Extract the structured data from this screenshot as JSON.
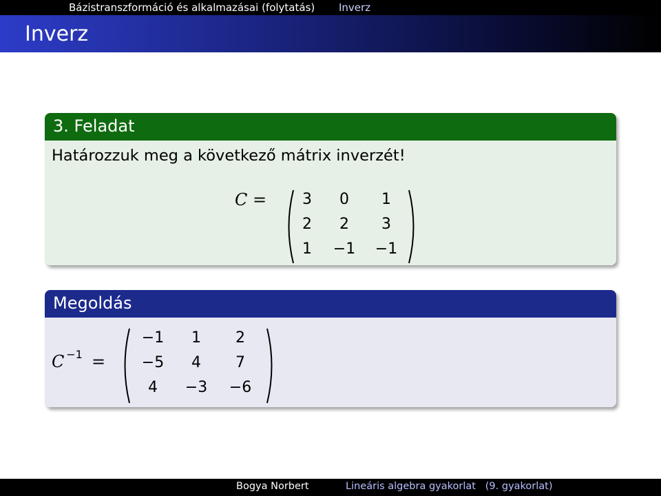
{
  "header": {
    "section": "Bázistranszformáció és alkalmazásai (folytatás)",
    "subsection": "Inverz"
  },
  "frame_title": "Inverz",
  "exercise": {
    "title": "3. Feladat",
    "text": "Határozzuk meg a következő mátrix inverzét!",
    "lhs": "C =",
    "matrix": [
      [
        "3",
        "0",
        "1"
      ],
      [
        "2",
        "2",
        "3"
      ],
      [
        "1",
        "−1",
        "−1"
      ]
    ]
  },
  "solution": {
    "title": "Megoldás",
    "lhs_base": "C",
    "lhs_exp": "−1",
    "lhs_eq": "=",
    "matrix": [
      [
        "−1",
        "1",
        "2"
      ],
      [
        "−5",
        "4",
        "7"
      ],
      [
        "4",
        "−3",
        "−6"
      ]
    ]
  },
  "footer": {
    "author": "Bogya Norbert",
    "course": "Lineáris algebra gyakorlat   (9. gyakorlat)"
  }
}
